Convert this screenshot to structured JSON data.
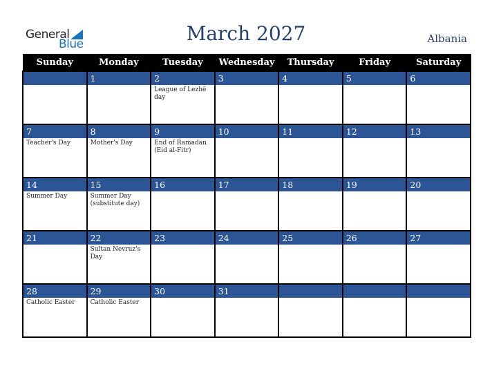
{
  "logo": {
    "general": "General",
    "blue": "Blue"
  },
  "header": {
    "title": "March 2027",
    "country": "Albania"
  },
  "weekdays": [
    "Sunday",
    "Monday",
    "Tuesday",
    "Wednesday",
    "Thursday",
    "Friday",
    "Saturday"
  ],
  "weeks": [
    [
      {
        "day": "",
        "event": ""
      },
      {
        "day": "1",
        "event": ""
      },
      {
        "day": "2",
        "event": "League of Lezhë day"
      },
      {
        "day": "3",
        "event": ""
      },
      {
        "day": "4",
        "event": ""
      },
      {
        "day": "5",
        "event": ""
      },
      {
        "day": "6",
        "event": ""
      }
    ],
    [
      {
        "day": "7",
        "event": "Teacher's Day"
      },
      {
        "day": "8",
        "event": "Mother's Day"
      },
      {
        "day": "9",
        "event": "End of Ramadan (Eid al-Fitr)"
      },
      {
        "day": "10",
        "event": ""
      },
      {
        "day": "11",
        "event": ""
      },
      {
        "day": "12",
        "event": ""
      },
      {
        "day": "13",
        "event": ""
      }
    ],
    [
      {
        "day": "14",
        "event": "Summer Day"
      },
      {
        "day": "15",
        "event": "Summer Day (substitute day)"
      },
      {
        "day": "16",
        "event": ""
      },
      {
        "day": "17",
        "event": ""
      },
      {
        "day": "18",
        "event": ""
      },
      {
        "day": "19",
        "event": ""
      },
      {
        "day": "20",
        "event": ""
      }
    ],
    [
      {
        "day": "21",
        "event": ""
      },
      {
        "day": "22",
        "event": "Sultan Nevruz's Day"
      },
      {
        "day": "23",
        "event": ""
      },
      {
        "day": "24",
        "event": ""
      },
      {
        "day": "25",
        "event": ""
      },
      {
        "day": "26",
        "event": ""
      },
      {
        "day": "27",
        "event": ""
      }
    ],
    [
      {
        "day": "28",
        "event": "Catholic Easter"
      },
      {
        "day": "29",
        "event": "Catholic Easter"
      },
      {
        "day": "30",
        "event": ""
      },
      {
        "day": "31",
        "event": ""
      },
      {
        "day": "",
        "event": ""
      },
      {
        "day": "",
        "event": ""
      },
      {
        "day": "",
        "event": ""
      }
    ]
  ],
  "colors": {
    "band": "#2c5596",
    "title": "#24406e",
    "logo_blue": "#1a73b8"
  }
}
